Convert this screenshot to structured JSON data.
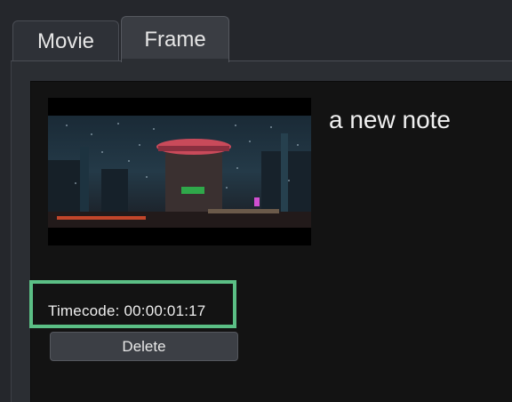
{
  "tabs": [
    {
      "label": "Movie",
      "active": false
    },
    {
      "label": "Frame",
      "active": true
    }
  ],
  "note": {
    "text": "a new note",
    "thumbnail_alt": "video frame thumbnail"
  },
  "timecode": {
    "label": "Timecode: 00:00:01:17"
  },
  "actions": {
    "delete_label": "Delete"
  },
  "colors": {
    "highlight": "#5bbf85",
    "background": "#25272c",
    "content_bg": "#131313"
  }
}
